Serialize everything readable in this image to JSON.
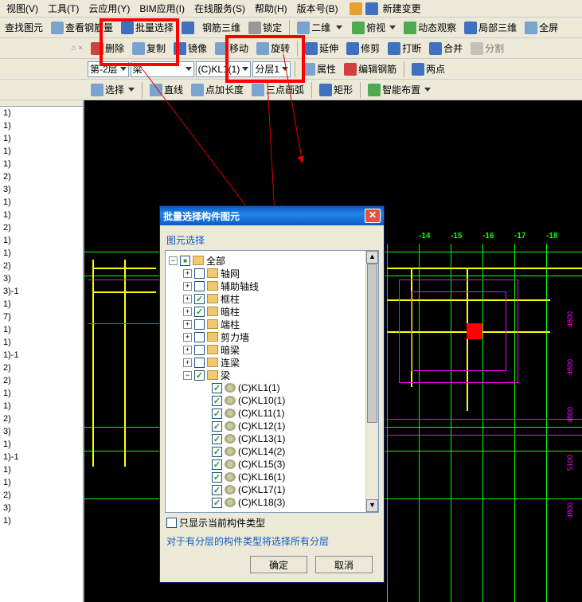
{
  "menu": {
    "view": "视图(V)",
    "tools": "工具(T)",
    "cloud": "云应用(Y)",
    "bim": "BIM应用(I)",
    "online": "在线服务(S)",
    "help": "帮助(H)",
    "ver": "版本号(B)",
    "newchange": "新建变更"
  },
  "tb1": {
    "find": "查找图元",
    "viewrebar": "查看钢筋量",
    "batch": "批量选择",
    "rebar3d": "钢筋三维",
    "lock": "锁定",
    "d2": "二维",
    "side": "俯视",
    "dyn": "动态观察",
    "local3d": "局部三维",
    "full": "全屏"
  },
  "tb2": {
    "del": "删除",
    "copy": "复制",
    "mirror": "镜像",
    "move": "移动",
    "rotate": "旋转",
    "extend": "延伸",
    "trim": "修剪",
    "break": "打断",
    "merge": "合并",
    "split": "分割"
  },
  "tb3": {
    "floor": "第-2层",
    "cat": "梁",
    "member": "(C)KL1(1)",
    "layer": "分层1",
    "prop": "属性",
    "editrebar": "编辑钢筋",
    "twopt": "两点"
  },
  "tb4": {
    "select": "选择",
    "line": "直线",
    "arc": "点加长度",
    "arc3": "三点画弧",
    "rect": "矩形",
    "smart": "智能布置"
  },
  "sidebar": [
    "1)",
    "1)",
    "1)",
    "1)",
    "1)",
    "2)",
    "3)",
    "1)",
    "1)",
    "2)",
    "1)",
    "1)",
    "2)",
    "3)",
    "3)-1",
    "1)",
    "7)",
    "1)",
    "1)",
    "1)-1",
    "2)",
    "2)",
    "1)",
    "1)",
    "2)",
    "3)",
    "1)",
    "1)-1",
    "1)",
    "1)",
    "2)",
    "3)",
    "1)"
  ],
  "dialog": {
    "title": "批量选择构件图元",
    "group": "图元选择",
    "root": "全部",
    "cats": [
      {
        "label": "轴网",
        "chk": false
      },
      {
        "label": "辅助轴线",
        "chk": false
      },
      {
        "label": "框柱",
        "chk": true
      },
      {
        "label": "暗柱",
        "chk": true
      },
      {
        "label": "端柱",
        "chk": false
      },
      {
        "label": "剪力墙",
        "chk": false
      },
      {
        "label": "暗梁",
        "chk": false
      },
      {
        "label": "连梁",
        "chk": false
      }
    ],
    "beam_label": "梁",
    "beams": [
      "(C)KL1(1)",
      "(C)KL10(1)",
      "(C)KL11(1)",
      "(C)KL12(1)",
      "(C)KL13(1)",
      "(C)KL14(2)",
      "(C)KL15(3)",
      "(C)KL16(1)",
      "(C)KL17(1)",
      "(C)KL18(3)"
    ],
    "onlycurrent": "只显示当前构件类型",
    "note": "对于有分层的构件类型将选择所有分层",
    "ok": "确定",
    "cancel": "取消"
  },
  "axis_top": [
    "-14",
    "-15",
    "-16",
    "-17",
    "-18"
  ],
  "dims": [
    "4800",
    "4800",
    "4800",
    "5100",
    "4800"
  ]
}
